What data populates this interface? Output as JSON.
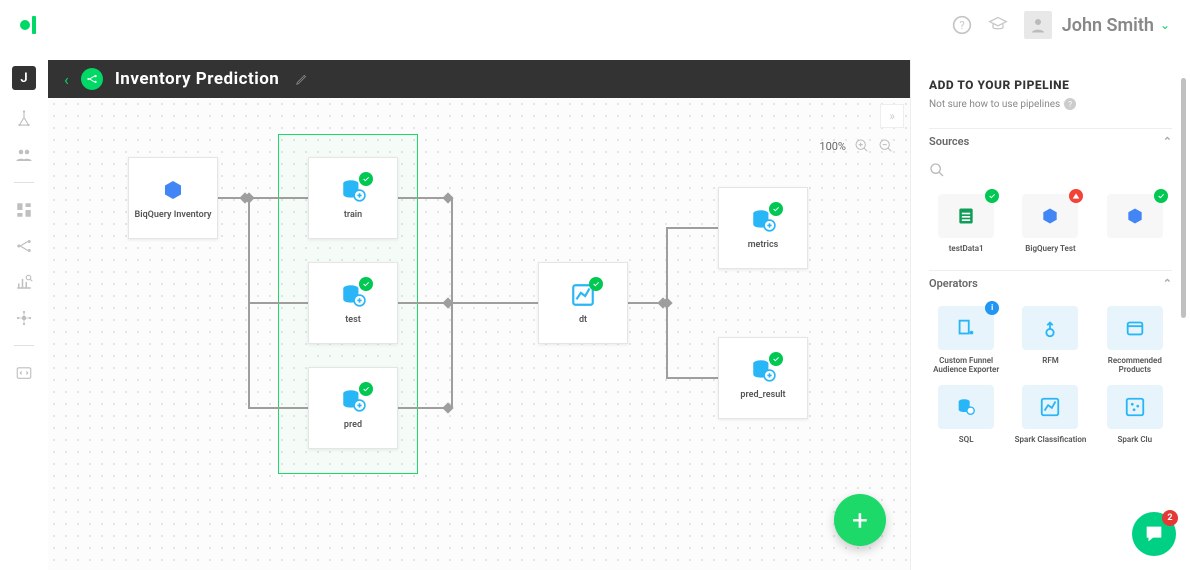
{
  "header": {
    "username": "John Smith"
  },
  "left_nav": {
    "badge": "J"
  },
  "workspace": {
    "title": "Inventory Prediction",
    "zoom": "100%",
    "nodes": {
      "source": "BiqQuery Inventory",
      "train": "train",
      "test": "test",
      "pred": "pred",
      "dt": "dt",
      "metrics": "metrics",
      "pred_result": "pred_result"
    }
  },
  "panel": {
    "title": "ADD TO YOUR PIPELINE",
    "subtitle": "Not sure how to use pipelines",
    "sections": {
      "sources": "Sources",
      "operators": "Operators"
    },
    "sources": [
      {
        "label": "testData1",
        "status": "ok",
        "iconColor": "#0f9d58"
      },
      {
        "label": "BigQuery Test",
        "status": "warn",
        "iconColor": "#4285f4"
      },
      {
        "label": "",
        "status": "ok",
        "iconColor": "#4285f4"
      }
    ],
    "operators": [
      {
        "label": "Custom Funnel Audience Exporter",
        "status": "info"
      },
      {
        "label": "RFM",
        "status": ""
      },
      {
        "label": "Recommended Products",
        "status": ""
      },
      {
        "label": "SQL",
        "status": ""
      },
      {
        "label": "Spark Classification",
        "status": ""
      },
      {
        "label": "Spark Clu",
        "status": ""
      }
    ]
  },
  "chat": {
    "count": "2"
  }
}
